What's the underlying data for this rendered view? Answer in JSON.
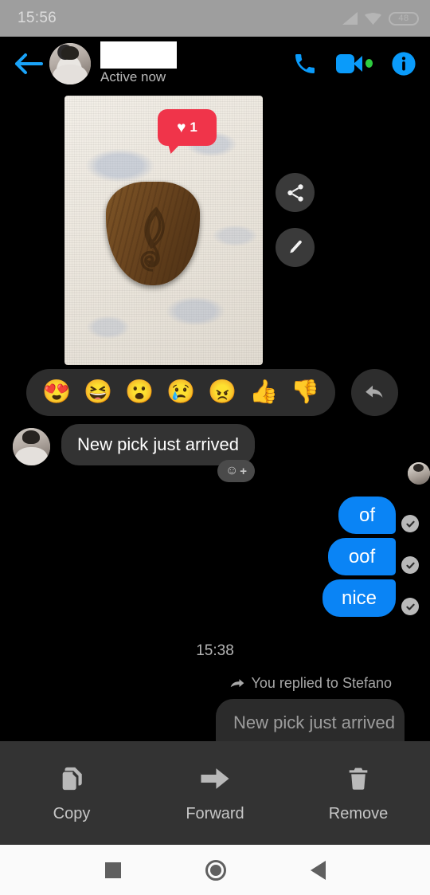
{
  "status_bar": {
    "time": "15:56",
    "battery_level": "48",
    "icons": [
      "signal-icon",
      "wifi-icon",
      "battery-icon"
    ]
  },
  "header": {
    "back_icon": "back-arrow-icon",
    "avatar": "contact-avatar",
    "name_redacted": true,
    "presence": "Active now",
    "call_icon": "phone-icon",
    "video_icon": "video-camera-icon",
    "video_active_dot": true,
    "info_icon": "info-icon",
    "accent_color": "#0a9bfa"
  },
  "conversation": {
    "photo_message": {
      "name": "guitar-pick-photo",
      "reaction": {
        "emoji": "♥",
        "count": "1",
        "badge_color": "#f0344a"
      },
      "overlay_actions": [
        {
          "name": "share-button",
          "icon": "share-icon"
        },
        {
          "name": "edit-button",
          "icon": "pencil-icon"
        }
      ]
    },
    "reaction_picker": {
      "emojis": [
        {
          "name": "heart-eyes-emoji",
          "glyph": "😍"
        },
        {
          "name": "laughing-emoji",
          "glyph": "😆"
        },
        {
          "name": "surprised-emoji",
          "glyph": "😮"
        },
        {
          "name": "sad-emoji",
          "glyph": "😢"
        },
        {
          "name": "angry-emoji",
          "glyph": "😠"
        },
        {
          "name": "thumbs-up-emoji",
          "glyph": "👍"
        },
        {
          "name": "thumbs-down-emoji",
          "glyph": "👎"
        }
      ],
      "reply_button_icon": "reply-arrow-icon"
    },
    "incoming_message": {
      "text": "New pick just arrived",
      "add_reaction_smiley": "☺",
      "add_reaction_plus": "+"
    },
    "outgoing_messages": [
      {
        "text": "of",
        "status_icon": "delivered-check-icon"
      },
      {
        "text": "oof",
        "status_icon": "delivered-check-icon"
      },
      {
        "text": "nice",
        "status_icon": "delivered-check-icon"
      }
    ],
    "bubble_color": "#0a84f5",
    "timestamp": "15:38",
    "reply_context": {
      "icon": "forward-arrow-icon",
      "text": "You replied to Stefano"
    },
    "quoted_message": "New pick just arrived"
  },
  "action_sheet": {
    "items": [
      {
        "name": "copy-action",
        "label": "Copy",
        "icon": "copy-icon"
      },
      {
        "name": "forward-action",
        "label": "Forward",
        "icon": "forward-arrow-icon"
      },
      {
        "name": "remove-action",
        "label": "Remove",
        "icon": "trash-icon"
      }
    ]
  },
  "nav_bar": {
    "recents_icon": "square-recents-icon",
    "home_icon": "circle-home-icon",
    "back_icon": "triangle-back-icon"
  }
}
